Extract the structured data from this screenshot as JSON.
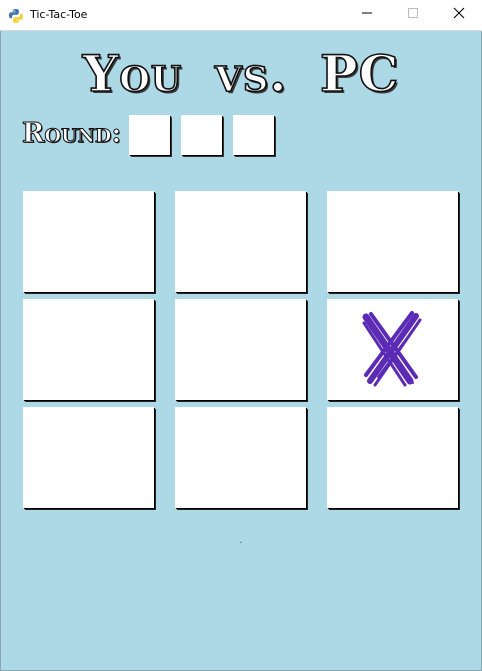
{
  "window": {
    "title": "Tic-Tac-Toe"
  },
  "header": {
    "title": "You  vs.  PC"
  },
  "round": {
    "label": "Round:",
    "boxes": [
      "",
      "",
      ""
    ]
  },
  "board": {
    "cells": [
      "",
      "",
      "",
      "",
      "",
      "X",
      "",
      "",
      ""
    ],
    "x_mark_color": "#5b2bb5"
  },
  "status": {
    "text": "."
  },
  "colors": {
    "background": "#add8e6",
    "cell": "#ffffff"
  },
  "icons": {
    "app": "python-icon",
    "minimize": "minimize-icon",
    "maximize": "maximize-icon",
    "close": "close-icon"
  }
}
